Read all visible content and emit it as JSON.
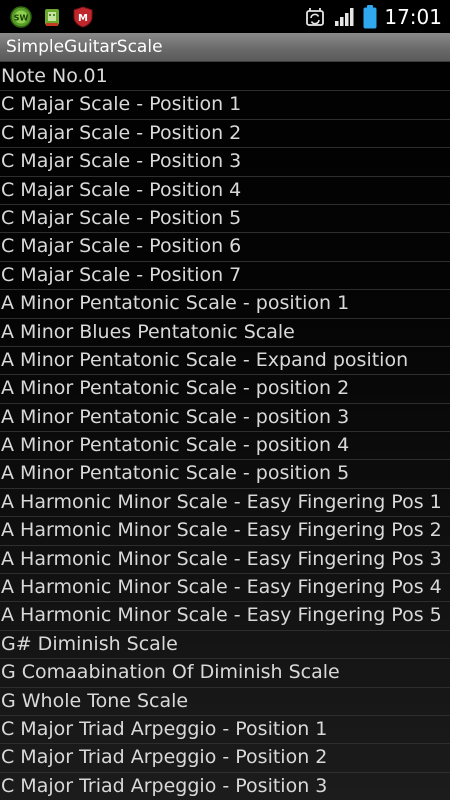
{
  "status_bar": {
    "notification_icons": [
      "SW",
      "android-icon",
      "M"
    ],
    "clock": "17:01",
    "battery_color": "#2fa8f0"
  },
  "app": {
    "title": "SimpleGuitarScale"
  },
  "list": {
    "items": [
      "Note No.01",
      "C Majar Scale - Position 1",
      "C Majar Scale - Position 2",
      "C Majar Scale - Position 3",
      "C Majar Scale - Position 4",
      "C Majar Scale - Position 5",
      "C Majar Scale - Position 6",
      "C Majar Scale - Position 7",
      "A Minor Pentatonic Scale - position 1",
      "A Minor Blues Pentatonic Scale",
      "A Minor Pentatonic Scale - Expand position",
      "A Minor Pentatonic Scale - position 2",
      "A Minor Pentatonic Scale - position 3",
      "A Minor Pentatonic Scale - position 4",
      "A Minor Pentatonic Scale - position 5",
      "A Harmonic Minor Scale - Easy Fingering Pos 1",
      "A Harmonic Minor Scale - Easy Fingering Pos 2",
      "A Harmonic Minor Scale - Easy Fingering Pos 3",
      "A Harmonic Minor Scale - Easy Fingering Pos 4",
      "A Harmonic Minor Scale - Easy Fingering Pos 5",
      "G# Diminish Scale",
      "G Comaabination Of Diminish Scale",
      "G Whole Tone Scale",
      "C Major Triad Arpeggio - Position 1",
      "C Major Triad Arpeggio - Position 2",
      "C Major Triad Arpeggio - Position 3"
    ]
  }
}
